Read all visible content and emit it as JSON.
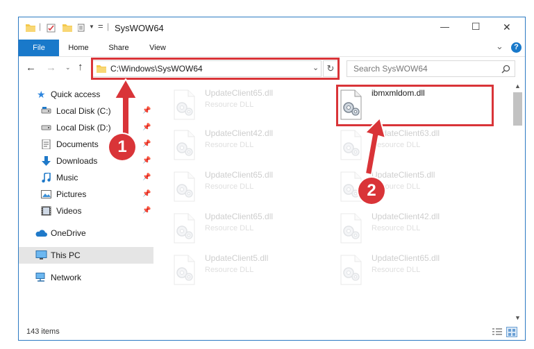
{
  "window": {
    "title": "SysWOW64",
    "accent": "#2b79c2",
    "controls": {
      "minimize": "—",
      "maximize": "☐",
      "close": "✕"
    }
  },
  "ribbon": {
    "tabs": [
      "File",
      "Home",
      "Share",
      "View"
    ],
    "chevron": "⌄",
    "help": "?"
  },
  "address": {
    "path": "C:\\Windows\\SysWOW64",
    "search_placeholder": "Search SysWOW64"
  },
  "sidebar": {
    "quick_access": "Quick access",
    "items": [
      {
        "label": "Local Disk (C:)",
        "icon": "drive-icon",
        "pinned": true
      },
      {
        "label": "Local Disk (D:)",
        "icon": "drive-icon",
        "pinned": true
      },
      {
        "label": "Documents",
        "icon": "documents-icon",
        "pinned": true
      },
      {
        "label": "Downloads",
        "icon": "downloads-icon",
        "pinned": true
      },
      {
        "label": "Music",
        "icon": "music-icon",
        "pinned": true
      },
      {
        "label": "Pictures",
        "icon": "pictures-icon",
        "pinned": true
      },
      {
        "label": "Videos",
        "icon": "videos-icon",
        "pinned": true
      }
    ],
    "onedrive": "OneDrive",
    "this_pc": "This PC",
    "network": "Network"
  },
  "files": [
    {
      "name": "UpdateClient65.dll",
      "type": "Resource DLL",
      "faded": true
    },
    {
      "name": "ibmxmldom.dll",
      "type": "",
      "faded": false
    },
    {
      "name": "UpdateClient42.dll",
      "type": "Resource DLL",
      "faded": true
    },
    {
      "name": "UpdateClient63.dll",
      "type": "Resource DLL",
      "faded": true
    },
    {
      "name": "UpdateClient65.dll",
      "type": "Resource DLL",
      "faded": true
    },
    {
      "name": "UpdateClient5.dll",
      "type": "Resource DLL",
      "faded": true
    },
    {
      "name": "UpdateClient65.dll",
      "type": "Resource DLL",
      "faded": true
    },
    {
      "name": "UpdateClient42.dll",
      "type": "Resource DLL",
      "faded": true
    },
    {
      "name": "UpdateClient5.dll",
      "type": "Resource DLL",
      "faded": true
    },
    {
      "name": "UpdateClient65.dll",
      "type": "Resource DLL",
      "faded": true
    }
  ],
  "status": {
    "count": "143 items"
  },
  "annotations": {
    "step1": "1",
    "step2": "2",
    "color": "#d93438"
  }
}
